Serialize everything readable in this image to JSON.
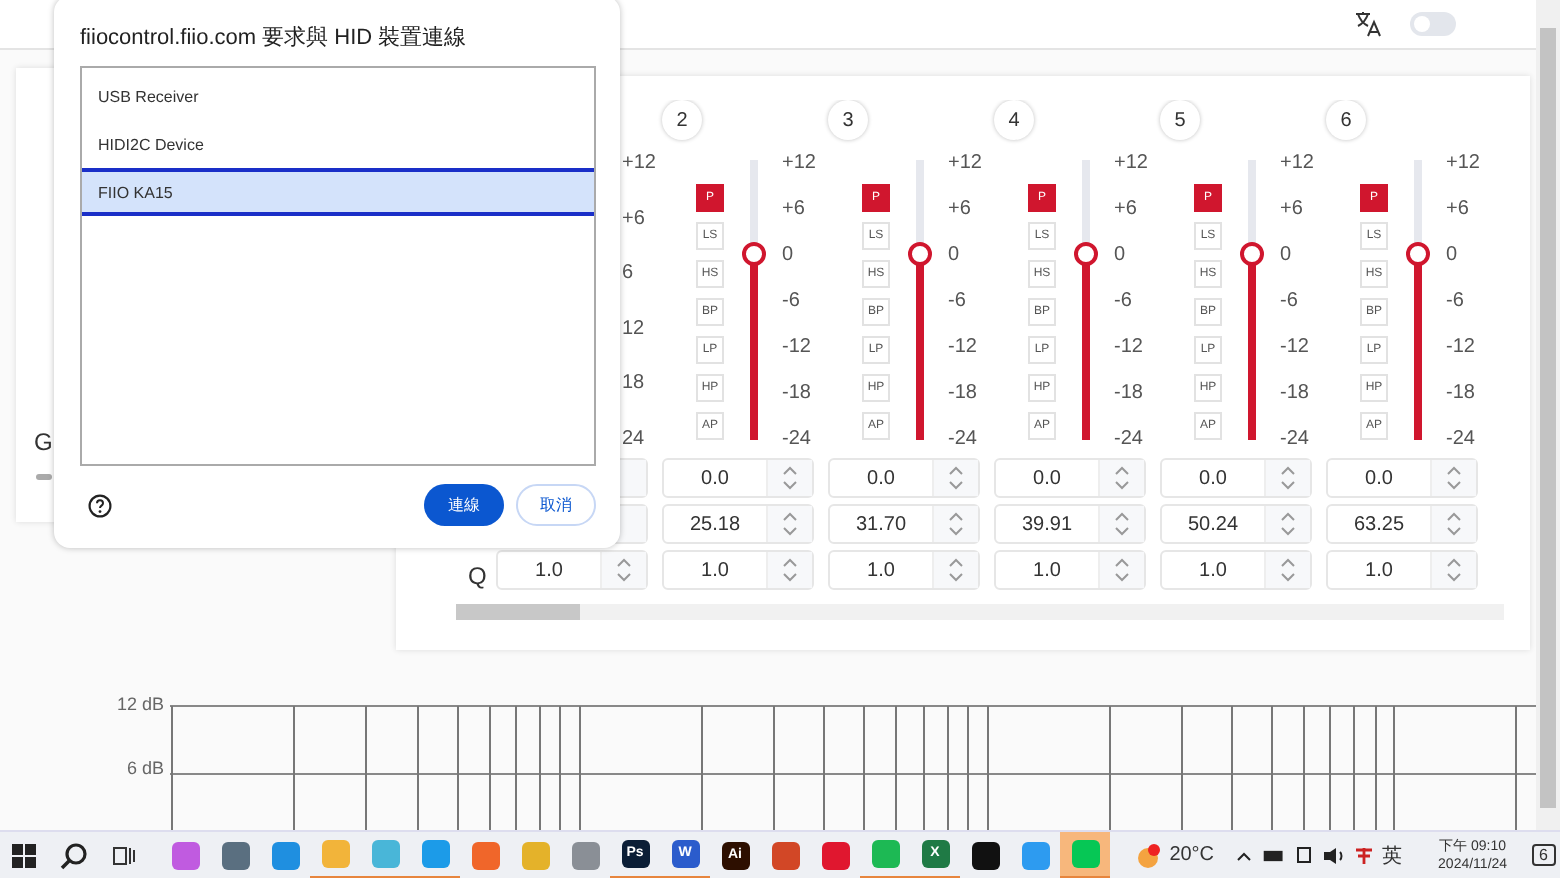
{
  "header": {
    "dark_mode": false
  },
  "left_card": {
    "label": "G"
  },
  "eq": {
    "row_labels": [
      "Q"
    ],
    "band_1": {
      "scale": [
        "+12",
        "+6",
        "6",
        "12",
        "18",
        "24"
      ],
      "q": "1.0"
    },
    "bands": [
      {
        "number": "2",
        "level": 0.667,
        "scale": [
          "+12",
          "+6",
          "0",
          "-6",
          "-12",
          "-18",
          "-24"
        ],
        "filters": [
          {
            "label": "P",
            "selected": true
          },
          {
            "label": "LS",
            "selected": false
          },
          {
            "label": "HS",
            "selected": false
          },
          {
            "label": "BP",
            "selected": false
          },
          {
            "label": "LP",
            "selected": false
          },
          {
            "label": "HP",
            "selected": false
          },
          {
            "label": "AP",
            "selected": false
          }
        ],
        "gain": "0.0",
        "freq": "25.18",
        "q": "1.0"
      },
      {
        "number": "3",
        "level": 0.667,
        "scale": [
          "+12",
          "+6",
          "0",
          "-6",
          "-12",
          "-18",
          "-24"
        ],
        "filters": [
          {
            "label": "P",
            "selected": true
          },
          {
            "label": "LS",
            "selected": false
          },
          {
            "label": "HS",
            "selected": false
          },
          {
            "label": "BP",
            "selected": false
          },
          {
            "label": "LP",
            "selected": false
          },
          {
            "label": "HP",
            "selected": false
          },
          {
            "label": "AP",
            "selected": false
          }
        ],
        "gain": "0.0",
        "freq": "31.70",
        "q": "1.0"
      },
      {
        "number": "4",
        "level": 0.667,
        "scale": [
          "+12",
          "+6",
          "0",
          "-6",
          "-12",
          "-18",
          "-24"
        ],
        "filters": [
          {
            "label": "P",
            "selected": true
          },
          {
            "label": "LS",
            "selected": false
          },
          {
            "label": "HS",
            "selected": false
          },
          {
            "label": "BP",
            "selected": false
          },
          {
            "label": "LP",
            "selected": false
          },
          {
            "label": "HP",
            "selected": false
          },
          {
            "label": "AP",
            "selected": false
          }
        ],
        "gain": "0.0",
        "freq": "39.91",
        "q": "1.0"
      },
      {
        "number": "5",
        "level": 0.667,
        "scale": [
          "+12",
          "+6",
          "0",
          "-6",
          "-12",
          "-18",
          "-24"
        ],
        "filters": [
          {
            "label": "P",
            "selected": true
          },
          {
            "label": "LS",
            "selected": false
          },
          {
            "label": "HS",
            "selected": false
          },
          {
            "label": "BP",
            "selected": false
          },
          {
            "label": "LP",
            "selected": false
          },
          {
            "label": "HP",
            "selected": false
          },
          {
            "label": "AP",
            "selected": false
          }
        ],
        "gain": "0.0",
        "freq": "50.24",
        "q": "1.0"
      },
      {
        "number": "6",
        "level": 0.667,
        "scale": [
          "+12",
          "+6",
          "0",
          "-6",
          "-12",
          "-18",
          "-24"
        ],
        "filters": [
          {
            "label": "P",
            "selected": true
          },
          {
            "label": "LS",
            "selected": false
          },
          {
            "label": "HS",
            "selected": false
          },
          {
            "label": "BP",
            "selected": false
          },
          {
            "label": "LP",
            "selected": false
          },
          {
            "label": "HP",
            "selected": false
          },
          {
            "label": "AP",
            "selected": false
          }
        ],
        "gain": "0.0",
        "freq": "63.25",
        "q": "1.0"
      }
    ]
  },
  "chart": {
    "labels": [
      "12 dB",
      "6 dB"
    ]
  },
  "dialog": {
    "title": "fiiocontrol.fiio.com 要求與 HID 裝置連線",
    "devices": [
      {
        "name": "USB Receiver",
        "selected": false
      },
      {
        "name": "HIDI2C Device",
        "selected": false
      },
      {
        "name": "FIIO KA15",
        "selected": true
      }
    ],
    "buttons": [
      {
        "label": "連線",
        "kind": "primary"
      },
      {
        "label": "取消",
        "kind": "secondary"
      }
    ]
  },
  "taskbar": {
    "apps": [
      {
        "color": "#c05be0",
        "active": false
      },
      {
        "color": "#5a6f80",
        "active": false
      },
      {
        "color": "#1f8fe0",
        "active": false
      },
      {
        "color": "#f2b43a",
        "active": true
      },
      {
        "color": "#49b6d8",
        "active": true
      },
      {
        "color": "#1c9be8",
        "active": true
      },
      {
        "color": "#f0662a",
        "active": false
      },
      {
        "color": "#e4b22a",
        "active": false
      },
      {
        "color": "#8a8f96",
        "active": false
      },
      {
        "color": "#0b1e36",
        "label": "Ps",
        "active": true
      },
      {
        "color": "#2b5ccc",
        "label": "W",
        "active": true
      },
      {
        "color": "#2d0f00",
        "label": "Ai",
        "active": false
      },
      {
        "color": "#d24726",
        "active": false
      },
      {
        "color": "#e0172f",
        "active": false
      },
      {
        "color": "#1db954",
        "active": true
      },
      {
        "color": "#1f7a45",
        "label": "X",
        "active": true
      },
      {
        "color": "#111111",
        "active": false
      },
      {
        "color": "#2d9bf0",
        "active": false
      },
      {
        "color": "#06c755",
        "active": true
      }
    ],
    "weather": "20°C",
    "ime": "英",
    "time": "下午 09:10",
    "date": "2024/11/24",
    "notifications": "6"
  }
}
